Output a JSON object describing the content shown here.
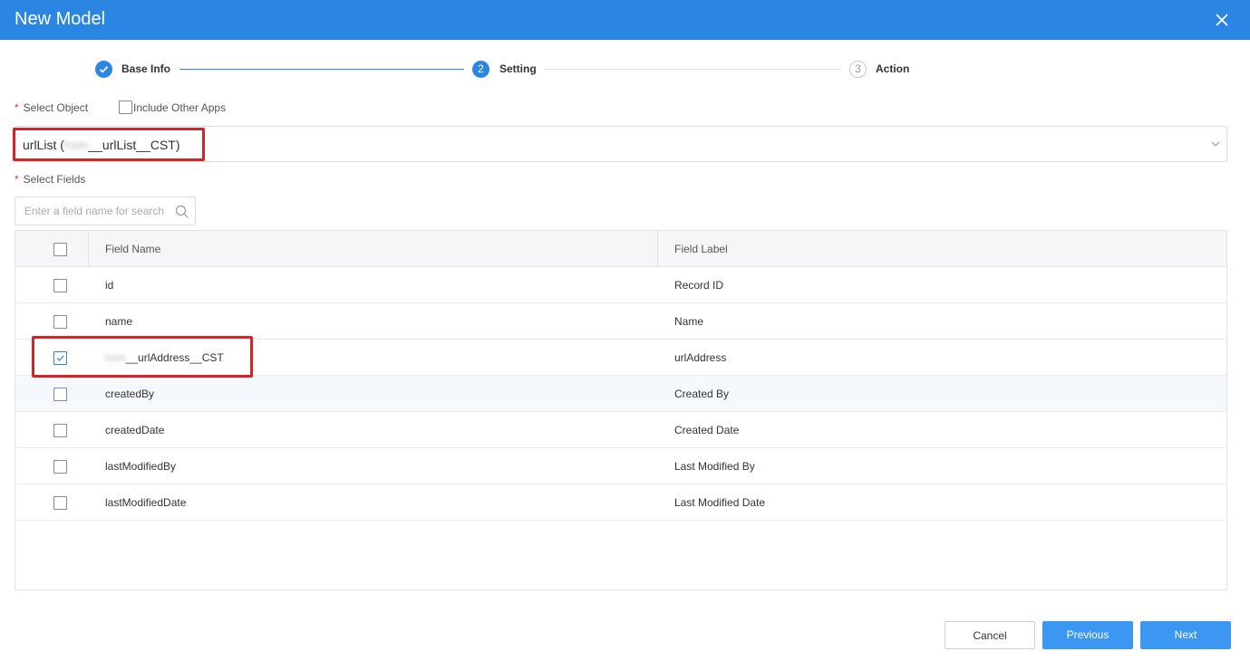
{
  "header": {
    "title": "New Model",
    "close_icon": "close-icon"
  },
  "steps": [
    {
      "number": "1",
      "label": "Base Info",
      "state": "done"
    },
    {
      "number": "2",
      "label": "Setting",
      "state": "active"
    },
    {
      "number": "3",
      "label": "Action",
      "state": "pending"
    }
  ],
  "form": {
    "object_label": "Select Object",
    "include_other_apps": {
      "label": "Include Other Apps",
      "checked": false
    },
    "selected_object": {
      "prefix": "urlList (",
      "blurred": "hxm",
      "suffix": "__urlList__CST)"
    },
    "fields_label": "Select Fields",
    "search_placeholder": "Enter a field name for search"
  },
  "table": {
    "columns": [
      "Field Name",
      "Field Label"
    ],
    "rows": [
      {
        "name": "id",
        "label": "Record ID",
        "checked": false
      },
      {
        "name": "name",
        "label": "Name",
        "checked": false
      },
      {
        "name_blurred": "hxm",
        "name": "__urlAddress__CST",
        "label": "urlAddress",
        "checked": true
      },
      {
        "name": "createdBy",
        "label": "Created By",
        "checked": false
      },
      {
        "name": "createdDate",
        "label": "Created Date",
        "checked": false
      },
      {
        "name": "lastModifiedBy",
        "label": "Last Modified By",
        "checked": false
      },
      {
        "name": "lastModifiedDate",
        "label": "Last Modified Date",
        "checked": false
      }
    ]
  },
  "footer": {
    "cancel": "Cancel",
    "previous": "Previous",
    "next": "Next"
  },
  "colors": {
    "primary": "#2b86e3",
    "button": "#3c97f3",
    "required": "#e03a2f",
    "highlight": "#d72323"
  }
}
